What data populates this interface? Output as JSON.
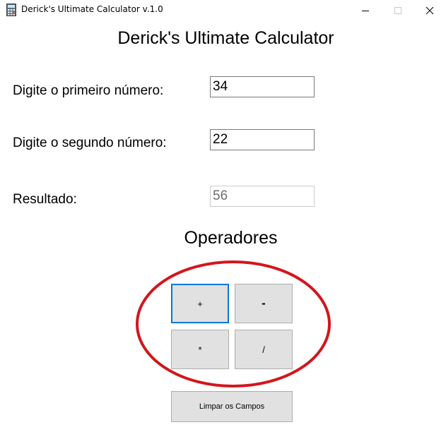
{
  "window": {
    "title": "Derick's Ultimate Calculator v.1.0",
    "icon": "calculator-icon",
    "controls": [
      "minimize-icon",
      "maximize-icon",
      "close-icon"
    ]
  },
  "header": {
    "title": "Derick's Ultimate Calculator"
  },
  "form": {
    "first_label": "Digite o primeiro número:",
    "first_value": "34",
    "second_label": "Digite o segundo número:",
    "second_value": "22",
    "result_label": "Resultado:",
    "result_value": "56"
  },
  "operators": {
    "title": "Operadores",
    "add": "+",
    "subtract": "-",
    "multiply": "*",
    "divide": "/"
  },
  "actions": {
    "clear_label": "Limpar os Campos"
  },
  "colors": {
    "focus_border": "#0078d7",
    "button_face": "#e1e1e1",
    "annotation_ring": "#d2161c"
  }
}
